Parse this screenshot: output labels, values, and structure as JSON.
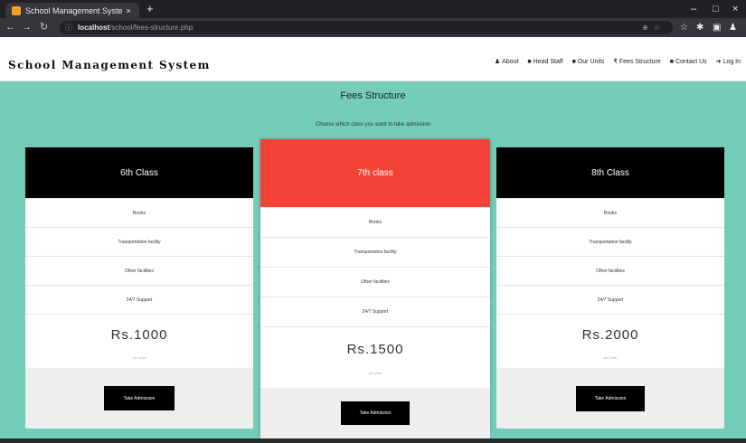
{
  "browser": {
    "tab_title": "School Management System",
    "tab_close": "×",
    "new_tab": "+",
    "window_controls": [
      "–",
      "□",
      "×"
    ],
    "nav": {
      "back": "←",
      "forward": "→",
      "reload": "↻"
    },
    "address": {
      "host": "localhost",
      "path": "/school/fees-structure.php"
    }
  },
  "site": {
    "brand": "School Management System",
    "menu": [
      {
        "icon": "user-icon",
        "glyph": "♟",
        "label": "About"
      },
      {
        "icon": "briefcase-icon",
        "glyph": "■",
        "label": "Head Staff"
      },
      {
        "icon": "book-icon",
        "glyph": "■",
        "label": "Our Units"
      },
      {
        "icon": "rupee-icon",
        "glyph": "₹",
        "label": "Fees Structure"
      },
      {
        "icon": "envelope-icon",
        "glyph": "■",
        "label": "Contact Us"
      },
      {
        "icon": "login-icon",
        "glyph": "➜",
        "label": "Log In"
      }
    ]
  },
  "page": {
    "title": "Fees Structure",
    "subtitle": "Choose which class you want to take admission"
  },
  "plans": [
    {
      "name": "6th Class",
      "features": [
        "Books",
        "Transportation facility",
        "Other facilities",
        "24/7 Support"
      ],
      "price": "Rs.1000",
      "note": "per year",
      "button": "Take Admission"
    },
    {
      "name": "7th class",
      "features": [
        "Books",
        "Transportation facility",
        "Other facilities",
        "24/7 Support"
      ],
      "price": "Rs.1500",
      "note": "per year",
      "button": "Take Admission"
    },
    {
      "name": "8th Class",
      "features": [
        "Books",
        "Transportation facility",
        "Other facilities",
        "24/7 Support"
      ],
      "price": "Rs.2000",
      "note": "per year",
      "button": "Take Admission"
    }
  ],
  "colors": {
    "background": "#73cdb9",
    "featured_header": "#f44336",
    "header": "#000000",
    "button": "#000000"
  }
}
